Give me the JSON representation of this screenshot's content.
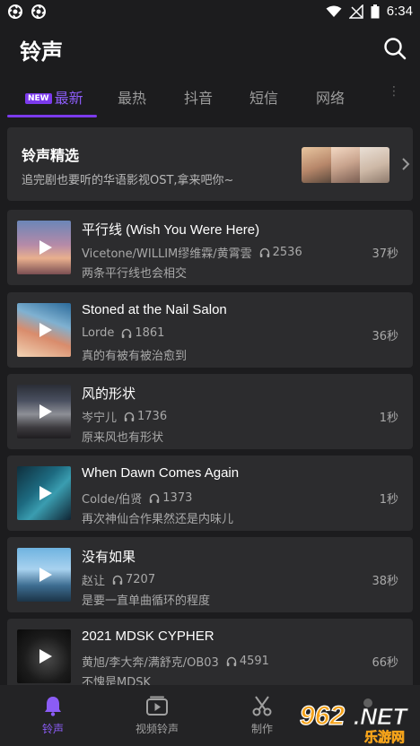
{
  "status_bar": {
    "time": "6:34"
  },
  "app": {
    "title": "铃声"
  },
  "tabs": [
    {
      "label": "最新",
      "badge": "NEW",
      "active": true
    },
    {
      "label": "最热"
    },
    {
      "label": "抖音"
    },
    {
      "label": "短信"
    },
    {
      "label": "网络"
    }
  ],
  "featured": {
    "title": "铃声精选",
    "subtitle": "追完剧也要听的华语影视OST,拿来吧你~"
  },
  "songs": [
    {
      "title": "平行线 (Wish You Were Here)",
      "artist": "Vicetone/WILLIM缪维霖/黄霄雲",
      "plays": "2536",
      "desc": "两条平行线也会相交",
      "duration": "37秒"
    },
    {
      "title": "Stoned at the Nail Salon",
      "artist": "Lorde",
      "plays": "1861",
      "desc": "真的有被有被治愈到",
      "duration": "36秒"
    },
    {
      "title": "风的形状",
      "artist": "岑宁儿",
      "plays": "1736",
      "desc": "原来风也有形状",
      "duration": "1秒"
    },
    {
      "title": "When Dawn Comes Again",
      "artist": "Colde/伯贤",
      "plays": "1373",
      "desc": "再次神仙合作果然还是内味儿",
      "duration": "1秒"
    },
    {
      "title": "没有如果",
      "artist": "赵让",
      "plays": "7207",
      "desc": "是要一直单曲循环的程度",
      "duration": "38秒"
    },
    {
      "title": "2021 MDSK CYPHER",
      "artist": "黄旭/李大奔/满舒克/OB03",
      "plays": "4591",
      "desc": "不愧是MDSK",
      "duration": "66秒"
    }
  ],
  "bottom_nav": [
    {
      "label": "铃声",
      "icon": "bell-icon",
      "active": true
    },
    {
      "label": "视频铃声",
      "icon": "video-icon"
    },
    {
      "label": "制作",
      "icon": "scissors-icon"
    }
  ],
  "watermark": {
    "brand": "962.NET",
    "sub": "乐游网"
  },
  "colors": {
    "accent": "#7c3aed",
    "background": "#1c1c1e",
    "card": "#2c2c2e"
  }
}
